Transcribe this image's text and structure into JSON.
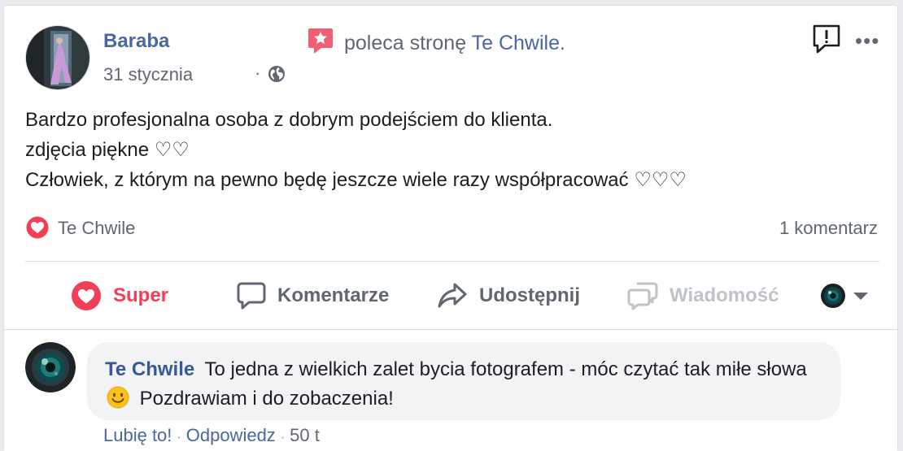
{
  "post": {
    "author": "Baraba",
    "date": "31 stycznia",
    "dot": "·",
    "visibility_icon": "globe-icon",
    "recommendation_icon": "recommend-star-icon",
    "recommends_text": "poleca stronę",
    "page_name": "Te Chwile",
    "page_suffix": ".",
    "report_icon": "report-icon",
    "more_icon": "more-options-icon",
    "more_label": "•••",
    "text_lines": [
      "Bardzo profesjonalna osoba z dobrym podejściem do klienta.",
      "zdjęcia piękne ♡♡",
      "Człowiek, z którym na pewno będę jeszcze wiele razy współpracować ♡♡♡"
    ]
  },
  "reactions": {
    "icon": "love-reaction-icon",
    "name": "Te Chwile",
    "comment_count": "1 komentarz"
  },
  "actions": {
    "super": "Super",
    "comment": "Komentarze",
    "share": "Udostępnij",
    "message": "Wiadomość",
    "audience_icon": "page-avatar-dropdown-icon"
  },
  "comment": {
    "author": "Te Chwile",
    "text_before_emoji": "To jedna z wielkich zalet bycia fotografem - móc czytać tak miłe słowa",
    "emoji": "smile-emoji-icon",
    "text_after_emoji": "Pozdrawiam i do zobaczenia!",
    "like": "Lubię to!",
    "reply": "Odpowiedz",
    "sep": "·",
    "time": "50 t"
  },
  "colors": {
    "link_blue": "#4b67a1",
    "love_red": "#f33e58",
    "secondary_text": "#606770",
    "disabled": "#bec3c9"
  }
}
